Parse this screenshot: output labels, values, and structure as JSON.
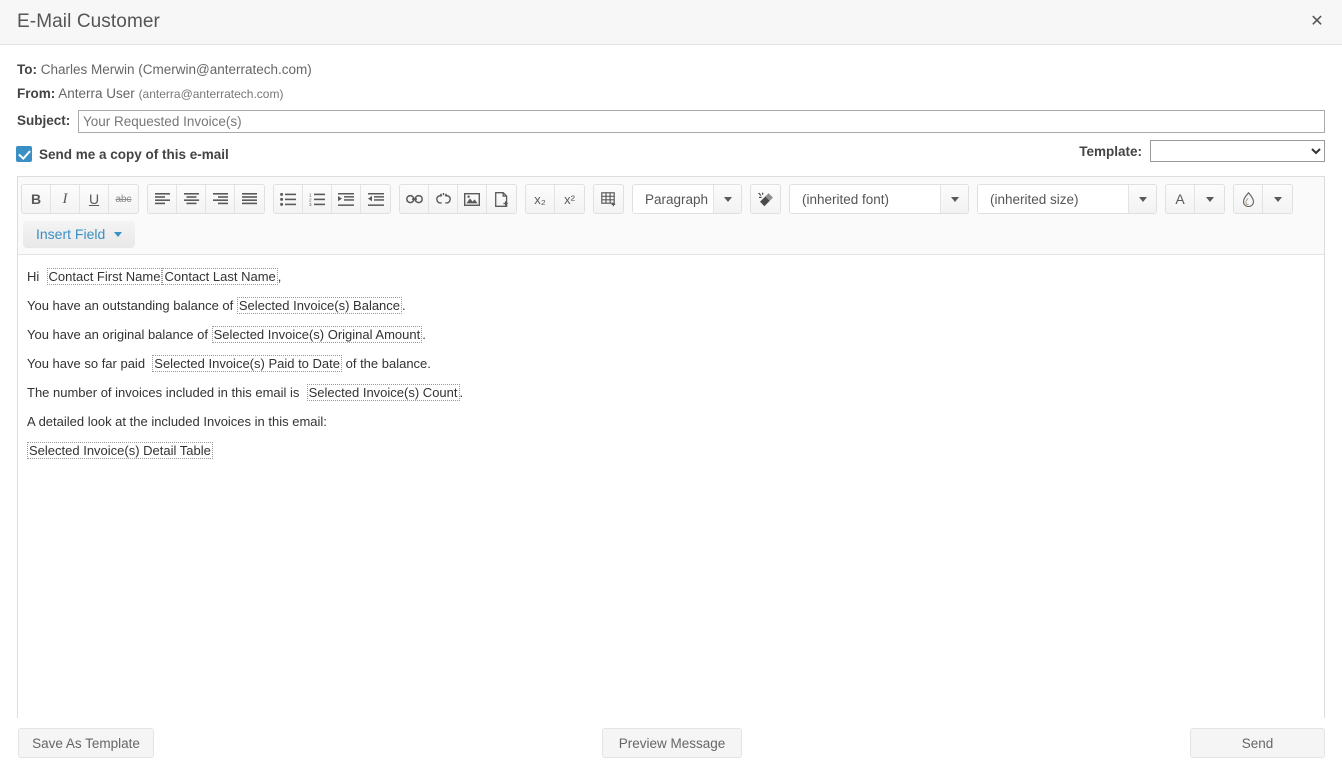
{
  "header": {
    "title": "E-Mail Customer",
    "close_icon": "close-icon"
  },
  "fields": {
    "to_label": "To:",
    "to_value": "Charles Merwin (Cmerwin@anterratech.com)",
    "from_label": "From:",
    "from_name": "Anterra User",
    "from_email": "(anterra@anterratech.com)",
    "subject_label": "Subject:",
    "subject_value": "Your Requested Invoice(s)",
    "subject_placeholder": "Your Requested Invoice(s)"
  },
  "options": {
    "copy_checkbox_label": "Send me a copy of this e-mail",
    "copy_checkbox_checked": true,
    "template_label": "Template:",
    "template_selected": "",
    "template_options": [
      ""
    ]
  },
  "toolbar": {
    "groups": [
      {
        "name": "text-style",
        "buttons": [
          {
            "name": "bold-button",
            "icon": "bold-icon",
            "label": "B"
          },
          {
            "name": "italic-button",
            "icon": "italic-icon",
            "label": "I"
          },
          {
            "name": "underline-button",
            "icon": "underline-icon",
            "label": "U"
          },
          {
            "name": "strikethrough-button",
            "icon": "strikethrough-icon",
            "label": "abc"
          }
        ]
      },
      {
        "name": "alignment",
        "buttons": [
          {
            "name": "align-left-button",
            "icon": "align-left-icon"
          },
          {
            "name": "align-center-button",
            "icon": "align-center-icon"
          },
          {
            "name": "align-right-button",
            "icon": "align-right-icon"
          },
          {
            "name": "align-justify-button",
            "icon": "align-justify-icon"
          }
        ]
      },
      {
        "name": "lists",
        "buttons": [
          {
            "name": "bullet-list-button",
            "icon": "bullet-list-icon"
          },
          {
            "name": "numbered-list-button",
            "icon": "numbered-list-icon"
          },
          {
            "name": "indent-button",
            "icon": "indent-icon"
          },
          {
            "name": "outdent-button",
            "icon": "outdent-icon"
          }
        ]
      },
      {
        "name": "insert",
        "buttons": [
          {
            "name": "insert-link-button",
            "icon": "link-icon"
          },
          {
            "name": "remove-link-button",
            "icon": "unlink-icon"
          },
          {
            "name": "insert-image-button",
            "icon": "image-icon"
          },
          {
            "name": "insert-file-button",
            "icon": "file-add-icon"
          }
        ]
      },
      {
        "name": "script",
        "buttons": [
          {
            "name": "subscript-button",
            "icon": "subscript-icon",
            "label": "x₂"
          },
          {
            "name": "superscript-button",
            "icon": "superscript-icon",
            "label": "x²"
          }
        ]
      },
      {
        "name": "table",
        "buttons": [
          {
            "name": "insert-table-button",
            "icon": "table-icon"
          }
        ]
      }
    ],
    "paragraph_select": "Paragraph",
    "clear_formatting": {
      "name": "clear-formatting-button",
      "icon": "eraser-icon"
    },
    "font_select": "(inherited font)",
    "size_select": "(inherited size)",
    "text_color": {
      "name": "text-color-button",
      "icon": "font-color-icon",
      "label": "A"
    },
    "fill_color": {
      "name": "fill-color-button",
      "icon": "droplet-icon"
    },
    "insert_field_label": "Insert Field"
  },
  "body": {
    "lines": [
      {
        "id": "greeting",
        "parts": [
          {
            "t": "Hi  ",
            "merge": false
          },
          {
            "t": "Contact First Name",
            "merge": true
          },
          {
            "t": "Contact Last Name",
            "merge": true
          },
          {
            "t": ",",
            "merge": false
          }
        ]
      },
      {
        "id": "outstanding-balance",
        "parts": [
          {
            "t": "You have an outstanding balance of ",
            "merge": false
          },
          {
            "t": "Selected Invoice(s) Balance",
            "merge": true
          },
          {
            "t": ".",
            "merge": false
          }
        ]
      },
      {
        "id": "original-balance",
        "parts": [
          {
            "t": "You have an original balance of ",
            "merge": false
          },
          {
            "t": "Selected Invoice(s) Original Amount",
            "merge": true
          },
          {
            "t": ".",
            "merge": false
          }
        ]
      },
      {
        "id": "paid-to-date",
        "parts": [
          {
            "t": "You have so far paid  ",
            "merge": false
          },
          {
            "t": "Selected Invoice(s) Paid to Date",
            "merge": true
          },
          {
            "t": " of the balance.",
            "merge": false
          }
        ]
      },
      {
        "id": "invoice-count",
        "parts": [
          {
            "t": "The number of invoices included in this email is  ",
            "merge": false
          },
          {
            "t": "Selected Invoice(s) Count",
            "merge": true
          },
          {
            "t": ".",
            "merge": false
          }
        ]
      },
      {
        "id": "detail-intro",
        "parts": [
          {
            "t": "A detailed look at the included Invoices in this email:",
            "merge": false
          }
        ]
      },
      {
        "id": "detail-table",
        "parts": [
          {
            "t": "Selected Invoice(s) Detail Table",
            "merge": true
          }
        ]
      }
    ]
  },
  "footer": {
    "save_as_template": "Save As Template",
    "preview_message": "Preview Message",
    "send": "Send"
  },
  "colors": {
    "accent": "#3a90c4",
    "header_bg": "#f7f7f7",
    "toolbar_bg": "#fafafa",
    "border": "#dddddd",
    "text": "#444444"
  }
}
